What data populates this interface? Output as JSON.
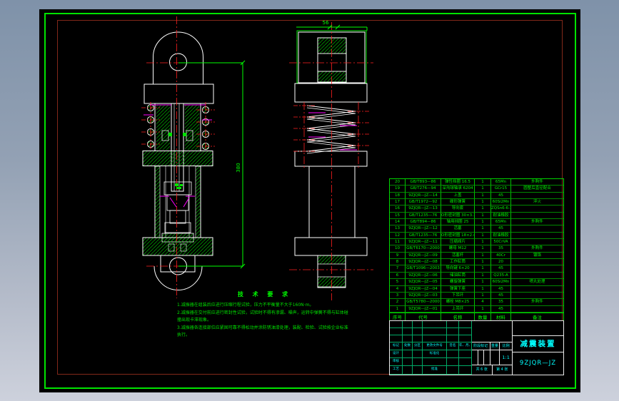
{
  "app": {
    "description": "CAD drawing viewport - damper assembly"
  },
  "colors": {
    "background_slate_top": "#7f92a9",
    "background_slate_bottom": "#cdd1dc",
    "canvas_black": "#000000",
    "frame_green": "#00e400",
    "frame_maroon": "#82281a",
    "line_white": "#ffffff",
    "centerline_red": "#ff2020",
    "cad_green": "#00ff00",
    "hatch_green": "#00b400",
    "detail_magenta": "#ff00ff",
    "titleblock_cyan": "#00ffff"
  },
  "dimensions": {
    "overall_length": "380",
    "top_width": "56"
  },
  "notes": {
    "title": "技 术 要 求",
    "items": [
      "1.减振器在组装后应进行压缩行程试验，压力不平衡量不大于160N·m。",
      "2.减振器在交付前应进行密封性试验，试验时不得有渗漏、噪声，运转中弹簧不得与缸体碰撞出现卡滞现象。",
      "3.减振器各连接部位应紧固可靠不得松动并涂防锈油漆处理，装配、检验、试验按企业标准执行。"
    ]
  },
  "bom": {
    "headers": [
      "序号",
      "代号",
      "名称",
      "数量",
      "材料",
      "备注"
    ],
    "rows": [
      [
        "20",
        "GB/T893—86",
        "弹性挡圈 16.5",
        "1",
        "65Mn",
        "外购件"
      ],
      [
        "19",
        "GB/T276—94",
        "深沟球轴承 6204",
        "1",
        "GCr15",
        "圆整后直径配合"
      ],
      [
        "18",
        "9ZJQR—JZ—14",
        "上盖",
        "1",
        "45",
        ""
      ],
      [
        "17",
        "GB/T1972—92",
        "碟形弹簧",
        "1",
        "60Si2Mn",
        "淬火"
      ],
      [
        "16",
        "9ZJQR—JZ—13",
        "导向套",
        "1",
        "ZQSn6-6-3",
        ""
      ],
      [
        "15",
        "GB/T1235—76",
        "O形密封圈 30×3.1",
        "1",
        "耐油橡胶",
        ""
      ],
      [
        "14",
        "GB/T894—86",
        "轴用挡圈 25",
        "1",
        "65Mn",
        "外购件"
      ],
      [
        "13",
        "9ZJQR—JZ—12",
        "活塞",
        "1",
        "45",
        ""
      ],
      [
        "12",
        "GB/T1235—76",
        "O形密封圈 18×2.4",
        "1",
        "耐油橡胶",
        ""
      ],
      [
        "11",
        "9ZJQR—JZ—11",
        "压缩阀片",
        "1",
        "50CrVA",
        ""
      ],
      [
        "10",
        "GB/T6170—2000",
        "螺母 M12",
        "1",
        "35",
        "外购件"
      ],
      [
        "9",
        "9ZJQR—JZ—09",
        "活塞杆",
        "1",
        "40Cr",
        "镀铬"
      ],
      [
        "8",
        "9ZJQR—JZ—08",
        "工作缸筒",
        "1",
        "20",
        ""
      ],
      [
        "7",
        "GB/T1096—2003",
        "导向键 6×20",
        "1",
        "45",
        ""
      ],
      [
        "6",
        "9ZJQR—JZ—06",
        "储油缸筒",
        "1",
        "Q235-A",
        ""
      ],
      [
        "5",
        "9ZJQR—JZ—05",
        "螺旋弹簧",
        "1",
        "60Si2Mn",
        "喷丸处理"
      ],
      [
        "4",
        "9ZJQR—JZ—04",
        "弹簧下座",
        "1",
        "45",
        ""
      ],
      [
        "3",
        "9ZJQR—JZ—03",
        "下吊环",
        "1",
        "45",
        ""
      ],
      [
        "2",
        "GB/T5780—2000",
        "螺栓 M8×25",
        "4",
        "35",
        "外购件"
      ],
      [
        "1",
        "9ZJQR—JZ—01",
        "上吊环",
        "1",
        "45",
        ""
      ]
    ]
  },
  "title_block": {
    "revision_header": [
      "标记",
      "处数",
      "分区",
      "更改文件号",
      "签名",
      "年、月、日"
    ],
    "design_label": "设计",
    "standard_label": "标准化",
    "check_label": "审核",
    "process_label": "工艺",
    "approve_label": "批准",
    "stage_label": "阶段标记",
    "weight_label": "重量",
    "scale_label": "比例",
    "scale_value": "1:1",
    "sheet_total": "共 6 张",
    "sheet_no": "第 4 张",
    "title": "减震装置",
    "drawing_no": "9ZJQR—JZ"
  }
}
